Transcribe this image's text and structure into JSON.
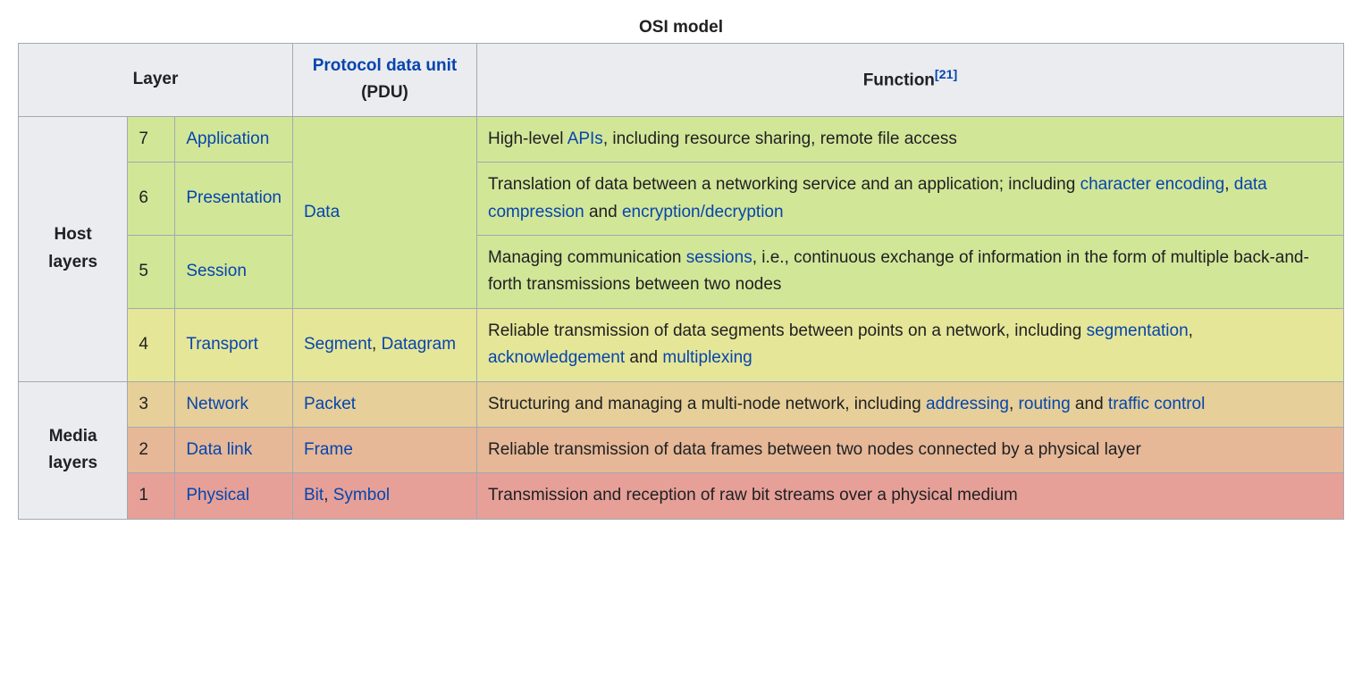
{
  "caption": "OSI model",
  "headers": {
    "layer": "Layer",
    "pdu_link": "Protocol data unit",
    "pdu_abbrev": " (PDU)",
    "function": "Function",
    "citation": "[21]"
  },
  "groups": {
    "host": "Host layers",
    "media": "Media layers"
  },
  "pdu": {
    "data": "Data",
    "segment": "Segment",
    "datagram": "Datagram",
    "packet": "Packet",
    "frame": "Frame",
    "bit": "Bit",
    "symbol": "Symbol"
  },
  "layers": {
    "7": {
      "num": "7",
      "name": "Application"
    },
    "6": {
      "num": "6",
      "name": "Presentation"
    },
    "5": {
      "num": "5",
      "name": "Session"
    },
    "4": {
      "num": "4",
      "name": "Transport"
    },
    "3": {
      "num": "3",
      "name": "Network"
    },
    "2": {
      "num": "2",
      "name": "Data link"
    },
    "1": {
      "num": "1",
      "name": "Physical"
    }
  },
  "func": {
    "7": {
      "pre": "High-level ",
      "apis": "APIs",
      "post": ", including resource sharing, remote file access"
    },
    "6": {
      "pre": "Translation of data between a networking service and an application; including ",
      "enc": "character encoding",
      "c1": ", ",
      "comp": "data compression",
      "c2": " and ",
      "crypt": "encryption/decryption"
    },
    "5": {
      "pre": "Managing communication ",
      "sessions": "sessions",
      "post": ", i.e., continuous exchange of information in the form of multiple back-and-forth transmissions between two nodes"
    },
    "4": {
      "pre": "Reliable transmission of data segments between points on a network, including ",
      "seg": "segmentation",
      "c1": ", ",
      "ack": "acknowledgement",
      "c2": " and ",
      "mux": "multiplexing"
    },
    "3": {
      "pre": "Structuring and managing a multi-node network, including ",
      "addr": "addressing",
      "c1": ", ",
      "route": "routing",
      "c2": " and ",
      "tc": "traffic control"
    },
    "2": {
      "text": "Reliable transmission of data frames between two nodes connected by a physical layer"
    },
    "1": {
      "text": "Transmission and reception of raw bit streams over a physical medium"
    }
  },
  "sep": {
    "comma": ", "
  }
}
